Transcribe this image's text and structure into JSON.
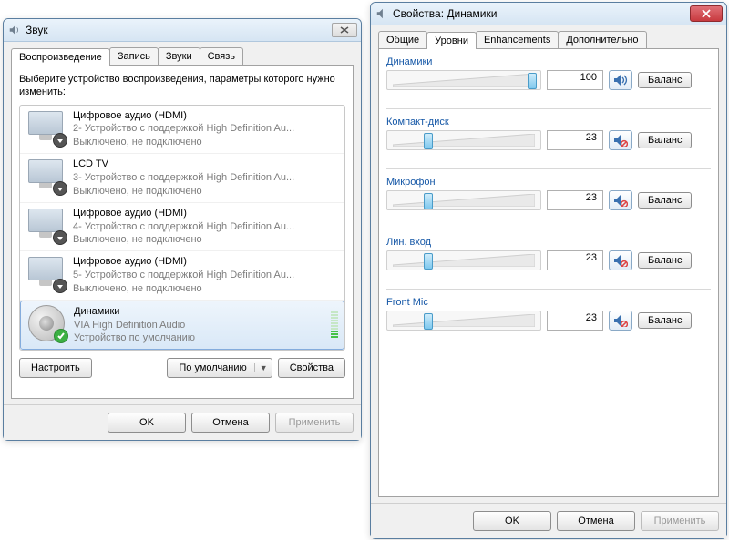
{
  "sound": {
    "title": "Звук",
    "tabs": [
      "Воспроизведение",
      "Запись",
      "Звуки",
      "Связь"
    ],
    "active_tab": 0,
    "instruction": "Выберите устройство воспроизведения, параметры которого нужно изменить:",
    "devices": [
      {
        "name": "Цифровое аудио (HDMI)",
        "line2": "2- Устройство с поддержкой High Definition Au...",
        "line3": "Выключено, не подключено",
        "icon": "monitor",
        "selected": false
      },
      {
        "name": "LCD TV",
        "line2": "3- Устройство с поддержкой High Definition Au...",
        "line3": "Выключено, не подключено",
        "icon": "monitor",
        "selected": false
      },
      {
        "name": "Цифровое аудио (HDMI)",
        "line2": "4- Устройство с поддержкой High Definition Au...",
        "line3": "Выключено, не подключено",
        "icon": "monitor",
        "selected": false
      },
      {
        "name": "Цифровое аудио (HDMI)",
        "line2": "5- Устройство с поддержкой High Definition Au...",
        "line3": "Выключено, не подключено",
        "icon": "monitor",
        "selected": false
      },
      {
        "name": "Динамики",
        "line2": "VIA High Definition Audio",
        "line3": "Устройство по умолчанию",
        "icon": "speaker",
        "selected": true
      }
    ],
    "buttons": {
      "configure": "Настроить",
      "default": "По умолчанию",
      "props": "Свойства",
      "ok": "OK",
      "cancel": "Отмена",
      "apply": "Применить"
    }
  },
  "props": {
    "title": "Свойства: Динамики",
    "tabs": [
      "Общие",
      "Уровни",
      "Enhancements",
      "Дополнительно"
    ],
    "active_tab": 1,
    "balance_label": "Баланс",
    "levels": [
      {
        "label": "Динамики",
        "value": 100,
        "muted": false
      },
      {
        "label": "Компакт-диск",
        "value": 23,
        "muted": true
      },
      {
        "label": "Микрофон",
        "value": 23,
        "muted": true
      },
      {
        "label": "Лин. вход",
        "value": 23,
        "muted": true
      },
      {
        "label": "Front Mic",
        "value": 23,
        "muted": true
      }
    ],
    "buttons": {
      "ok": "OK",
      "cancel": "Отмена",
      "apply": "Применить"
    }
  }
}
